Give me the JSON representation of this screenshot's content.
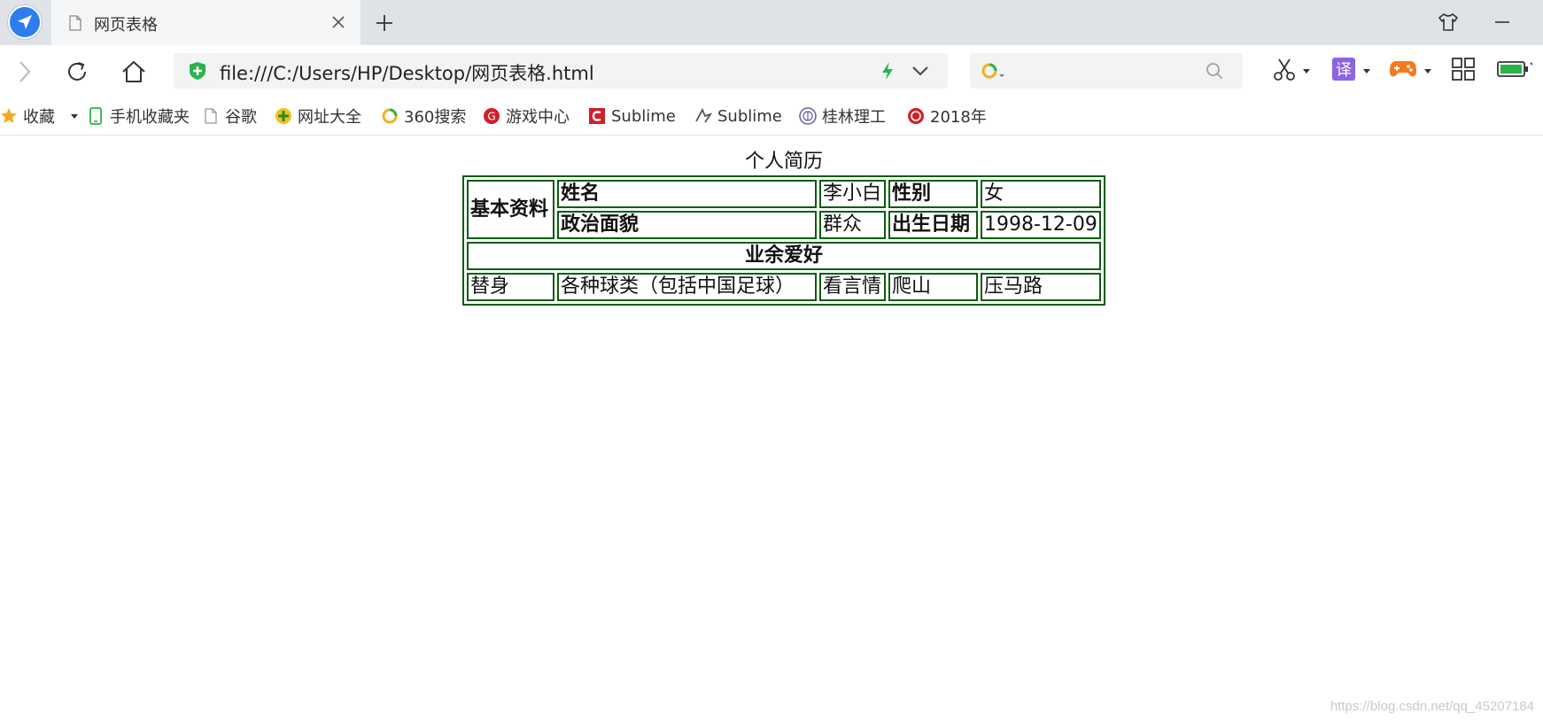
{
  "browser": {
    "tab": {
      "title": "网页表格"
    },
    "address": {
      "url": "file:///C:/Users/HP/Desktop/网页表格.html"
    },
    "search": {
      "placeholder": ""
    },
    "bookmarks": [
      {
        "label": "收藏",
        "icon": "star-icon"
      },
      {
        "label": "手机收藏夹",
        "icon": "phone-icon"
      },
      {
        "label": "谷歌",
        "icon": "doc-icon"
      },
      {
        "label": "网址大全",
        "icon": "plus-globe-icon"
      },
      {
        "label": "360搜索",
        "icon": "search-360-icon"
      },
      {
        "label": "游戏中心",
        "icon": "game-center-icon"
      },
      {
        "label": "Sublime",
        "icon": "sublime-icon"
      },
      {
        "label": "Sublime",
        "icon": "sublime-alt-icon"
      },
      {
        "label": "桂林理工",
        "icon": "university-icon"
      },
      {
        "label": "2018年",
        "icon": "festival-icon"
      }
    ],
    "colors": {
      "accent": "#2f7cf0",
      "table_border": "#0a5c0a"
    }
  },
  "page": {
    "caption": "个人简历",
    "rows": {
      "basic_label": "基本资料",
      "name_label": "姓名",
      "name_value": "李小白",
      "gender_label": "性别",
      "gender_value": "女",
      "politics_label": "政治面貌",
      "politics_value": "群众",
      "birth_label": "出生日期",
      "birth_value": "1998-12-09",
      "hobby_header": "业余爱好",
      "hobbies": [
        "替身",
        "各种球类（包括中国足球）",
        "看言情",
        "爬山",
        "压马路"
      ]
    },
    "watermark": "https://blog.csdn.net/qq_45207184"
  }
}
